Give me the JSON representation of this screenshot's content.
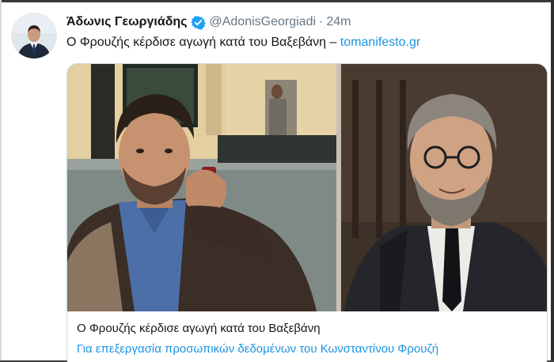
{
  "tweet": {
    "display_name": "Άδωνις Γεωργιάδης",
    "handle": "@AdonisGeorgiadi",
    "separator": "·",
    "time": "24m",
    "text": "Ο Φρουζής κέρδισε αγωγή κατά του Βαξεβάνη – ",
    "link_text": "tomanifesto.gr",
    "verified_icon": "verified-badge-icon",
    "accent_color": "#1b95e0"
  },
  "card": {
    "title": "Ο Φρουζής κέρδισε αγωγή κατά του Βαξεβάνη",
    "description": "Για επεξεργασία προσωπικών δεδομένων του Κωνσταντίνου Φρουζή"
  }
}
